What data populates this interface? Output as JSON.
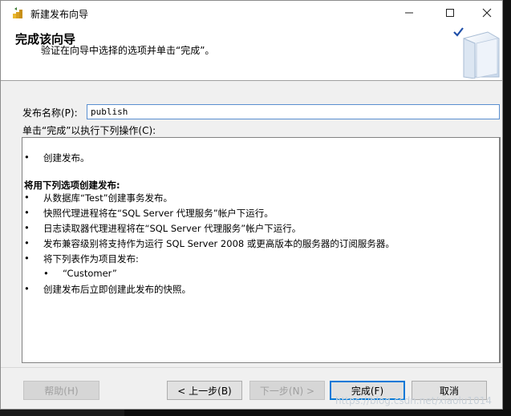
{
  "window": {
    "title": "新建发布向导",
    "controls": {
      "minimize": "—",
      "maximize": "☐",
      "close": "✕"
    }
  },
  "header": {
    "title": "完成该向导",
    "subtitle": "验证在向导中选择的选项并单击“完成”。"
  },
  "form": {
    "publication_name_label": "发布名称(P):",
    "publication_name_value": "publish",
    "actions_label": "单击“完成”以执行下列操作(C):"
  },
  "actions": [
    {
      "bullet": "•",
      "text": "创建发布。"
    },
    {
      "bullet": "",
      "text": "将用下列选项创建发布:",
      "bold": true
    },
    {
      "bullet": "•",
      "text": "从数据库“Test”创建事务发布。"
    },
    {
      "bullet": "•",
      "text": "快照代理进程将在“SQL Server 代理服务”帐户下运行。"
    },
    {
      "bullet": "•",
      "text": "日志读取器代理进程将在“SQL Server 代理服务”帐户下运行。"
    },
    {
      "bullet": "•",
      "text": "发布兼容级别将支持作为运行 SQL Server 2008 或更高版本的服务器的订阅服务器。"
    },
    {
      "bullet": "•",
      "text": "将下列表作为项目发布:"
    },
    {
      "bullet": "•",
      "text": "“Customer”",
      "indent": true
    },
    {
      "bullet": "•",
      "text": "创建发布后立即创建此发布的快照。"
    }
  ],
  "buttons": {
    "help": "帮助(H)",
    "back": "< 上一步(B)",
    "next": "下一步(N) >",
    "finish": "完成(F)",
    "cancel": "取消"
  },
  "watermark": "https://blog.csdn.net/xiaolu1014"
}
